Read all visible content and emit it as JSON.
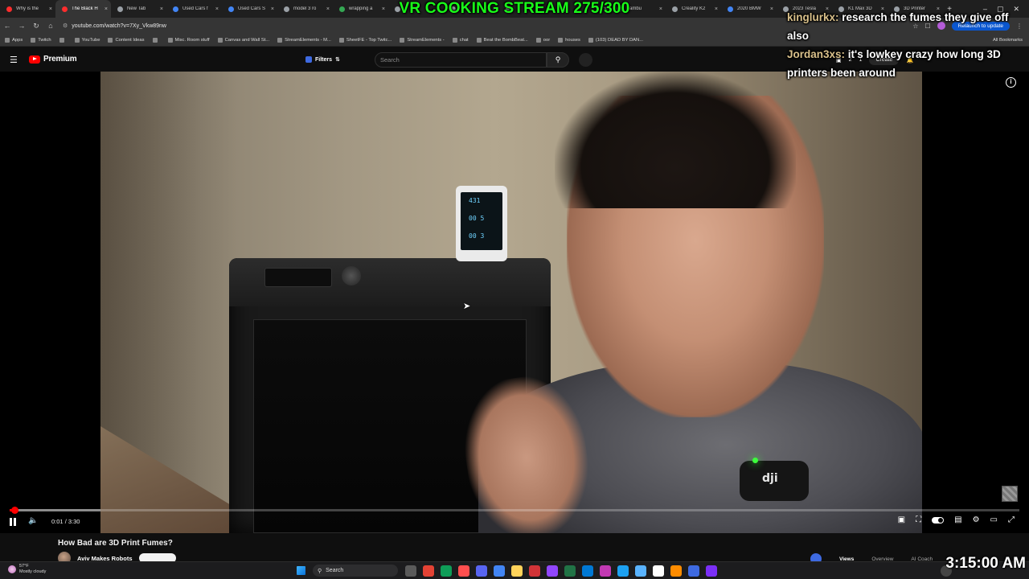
{
  "browser": {
    "tabs": [
      {
        "title": "Why is the",
        "favicon_color": "#ff2d2d"
      },
      {
        "title": "The Black H",
        "favicon_color": "#ff2d2d",
        "active": true
      },
      {
        "title": "New Tab",
        "favicon_color": "#9aa0a6"
      },
      {
        "title": "Used Cars f",
        "favicon_color": "#4285f4"
      },
      {
        "title": "Used Cars S",
        "favicon_color": "#4285f4"
      },
      {
        "title": "model 3 ro",
        "favicon_color": "#9aa0a6"
      },
      {
        "title": "wrapping a",
        "favicon_color": "#34a853"
      },
      {
        "title": "o",
        "favicon_color": "#9aa0a6"
      },
      {
        "title": "",
        "favicon_color": "#9aa0a6"
      },
      {
        "title": "",
        "favicon_color": "#9aa0a6"
      },
      {
        "title": "",
        "favicon_color": "#9aa0a6"
      },
      {
        "title": "Bambu",
        "favicon_color": "#34a853"
      },
      {
        "title": "Creality K2",
        "favicon_color": "#9aa0a6"
      },
      {
        "title": "2020 BMW",
        "favicon_color": "#4285f4"
      },
      {
        "title": "2023 Tesla",
        "favicon_color": "#9aa0a6"
      },
      {
        "title": "K1 Max 3D",
        "favicon_color": "#9aa0a6"
      },
      {
        "title": "3D Printer",
        "favicon_color": "#9aa0a6"
      }
    ],
    "url": "youtube.com/watch?v=7Xy_Vkw89nw",
    "relaunch_label": "Relaunch to update",
    "bookmarks": [
      "Apps",
      "Twitch",
      "",
      "YouTube",
      "Content Ideas",
      "",
      "Misc. Room stuff",
      "Canvas and Wall St...",
      "StreamElements - M...",
      "SheetFE - Top Twitc...",
      "StreamElements - ",
      "chat",
      "Beat the BombBeat...",
      "oor",
      "houses",
      "(103) DEAD BY DAN..."
    ],
    "all_bookmarks_label": "All Bookmarks"
  },
  "youtube": {
    "logo_label": "Premium",
    "filters_label": "Filters",
    "search_placeholder": "Search",
    "create_label": "Create",
    "notif_count_1": "2",
    "notif_count_2": "1"
  },
  "overlay": {
    "stream_title": "VR COOKING STREAM 275/300",
    "chat": [
      {
        "user": "kinglurkx:",
        "message": "research the fumes they give off also"
      },
      {
        "user": "Jordan3xs:",
        "message": "it's lowkey crazy how long 3D printers been around"
      }
    ]
  },
  "player": {
    "time_current": "0:01",
    "time_total": "3:30",
    "time_separator": " / ",
    "progress_fraction": 0.005,
    "buffer_fraction": 0.09,
    "air_monitor_readings": [
      "431",
      "00 5",
      "00 3"
    ],
    "mic_brand": "dji"
  },
  "video": {
    "title": "How Bad are 3D Print Fumes?",
    "channel": "Aviv Makes Robots",
    "tabs": [
      "Views",
      "Overview",
      "AI Coach"
    ]
  },
  "taskbar": {
    "temperature": "57°F",
    "weather": "Mostly cloudy",
    "search_placeholder": "Search",
    "app_colors": [
      "#5a5a5a",
      "#e34234",
      "#0f9d58",
      "#ff4f4f",
      "#5865f2",
      "#4285f4",
      "#ffd35a",
      "#d13438",
      "#9146ff",
      "#217346",
      "#0078d4",
      "#c239b3",
      "#1da1f2",
      "#59b3ff",
      "#ffffff",
      "#ff8c00",
      "#3e6ae1",
      "#7b2ff7"
    ]
  },
  "clock": "3:15:00 AM"
}
